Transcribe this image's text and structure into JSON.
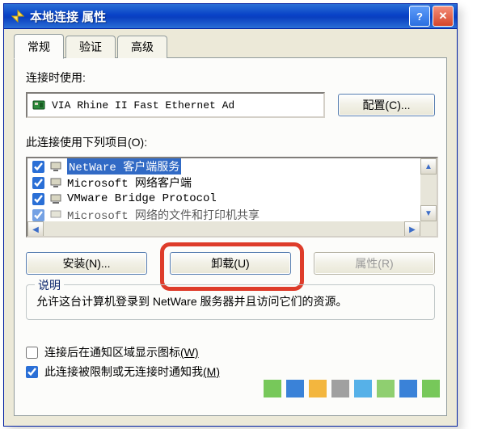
{
  "titlebar": {
    "title": "本地连接 属性"
  },
  "tabs": [
    {
      "label": "常规",
      "active": true
    },
    {
      "label": "验证",
      "active": false
    },
    {
      "label": "高级",
      "active": false
    }
  ],
  "labels": {
    "connect_using": "连接时使用:",
    "adapter_name": "VIA Rhine II Fast Ethernet Ad",
    "configure_btn": "配置(C)...",
    "items_label": "此连接使用下列项目(O):",
    "install_btn": "安装(N)...",
    "uninstall_btn": "卸载(U)",
    "properties_btn": "属性(R)",
    "desc_legend": "说明",
    "desc_text": "允许这台计算机登录到 NetWare 服务器并且访问它们的资源。"
  },
  "list_items": [
    {
      "checked": true,
      "selected": true,
      "text": "NetWare 客户端服务"
    },
    {
      "checked": true,
      "selected": false,
      "text": "Microsoft 网络客户端"
    },
    {
      "checked": true,
      "selected": false,
      "text": "VMware Bridge Protocol"
    },
    {
      "checked": true,
      "selected": false,
      "text": "Microsoft 网络的文件和打印机共享"
    }
  ],
  "bottom_checks": [
    {
      "checked": false,
      "label_pre": "连接后在通知区域显示图标",
      "hotkey": "(W)"
    },
    {
      "checked": true,
      "label_pre": "此连接被限制或无连接时通知我",
      "hotkey": "(M)"
    }
  ]
}
